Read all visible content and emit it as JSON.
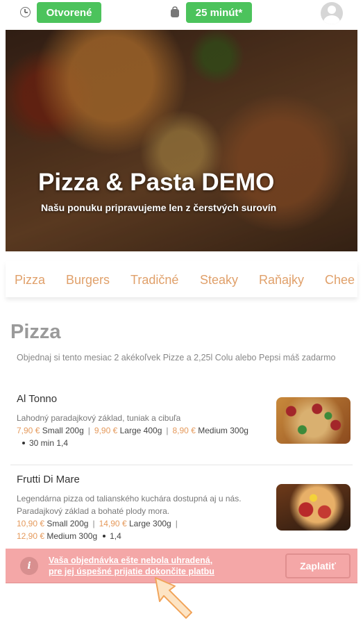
{
  "topbar": {
    "status": "Otvorené",
    "delivery_time": "25 minút*"
  },
  "hero": {
    "title": "Pizza & Pasta DEMO",
    "subtitle": "Našu ponuku pripravujeme len z čerstvých surovín"
  },
  "tabs": [
    "Pizza",
    "Burgers",
    "Tradičné",
    "Steaky",
    "Raňajky",
    "Chee"
  ],
  "section": {
    "title": "Pizza",
    "description": "Objednaj si tento mesiac 2 akékoľvek Pizze a 2,25l Colu alebo Pepsi máš zadarmo"
  },
  "items": [
    {
      "name": "Al Tonno",
      "description": "Lahodný paradajkový základ, tuniak a cibuľa",
      "variants": [
        {
          "price": "7,90 €",
          "size": "Small",
          "weight": "200g"
        },
        {
          "price": "9,90 €",
          "size": "Large",
          "weight": "400g"
        },
        {
          "price": "8,90 €",
          "size": "Medium",
          "weight": "300g"
        }
      ],
      "time": "30 min",
      "allergens": "1,4"
    },
    {
      "name": "Frutti Di Mare",
      "description": "Legendárna pizza od talianského kuchára dostupná aj u nás. Paradajkový základ a bohaté plody mora.",
      "variants": [
        {
          "price": "10,90 €",
          "size": "Small",
          "weight": "200g"
        },
        {
          "price": "14,90 €",
          "size": "Large",
          "weight": "300g"
        },
        {
          "price": "12,90 €",
          "size": "Medium",
          "weight": "300g"
        }
      ],
      "allergens": "1,4"
    }
  ],
  "alert": {
    "line1": "Vaša objednávka ešte nebola uhradená,",
    "line2": "pre jej úspešné prijatie dokončite platbu",
    "pay_label": "Zaplatiť",
    "icon": "info-icon"
  },
  "colors": {
    "green": "#4cc35c",
    "accent": "#e59a5c",
    "alert": "#f4a7a7"
  }
}
